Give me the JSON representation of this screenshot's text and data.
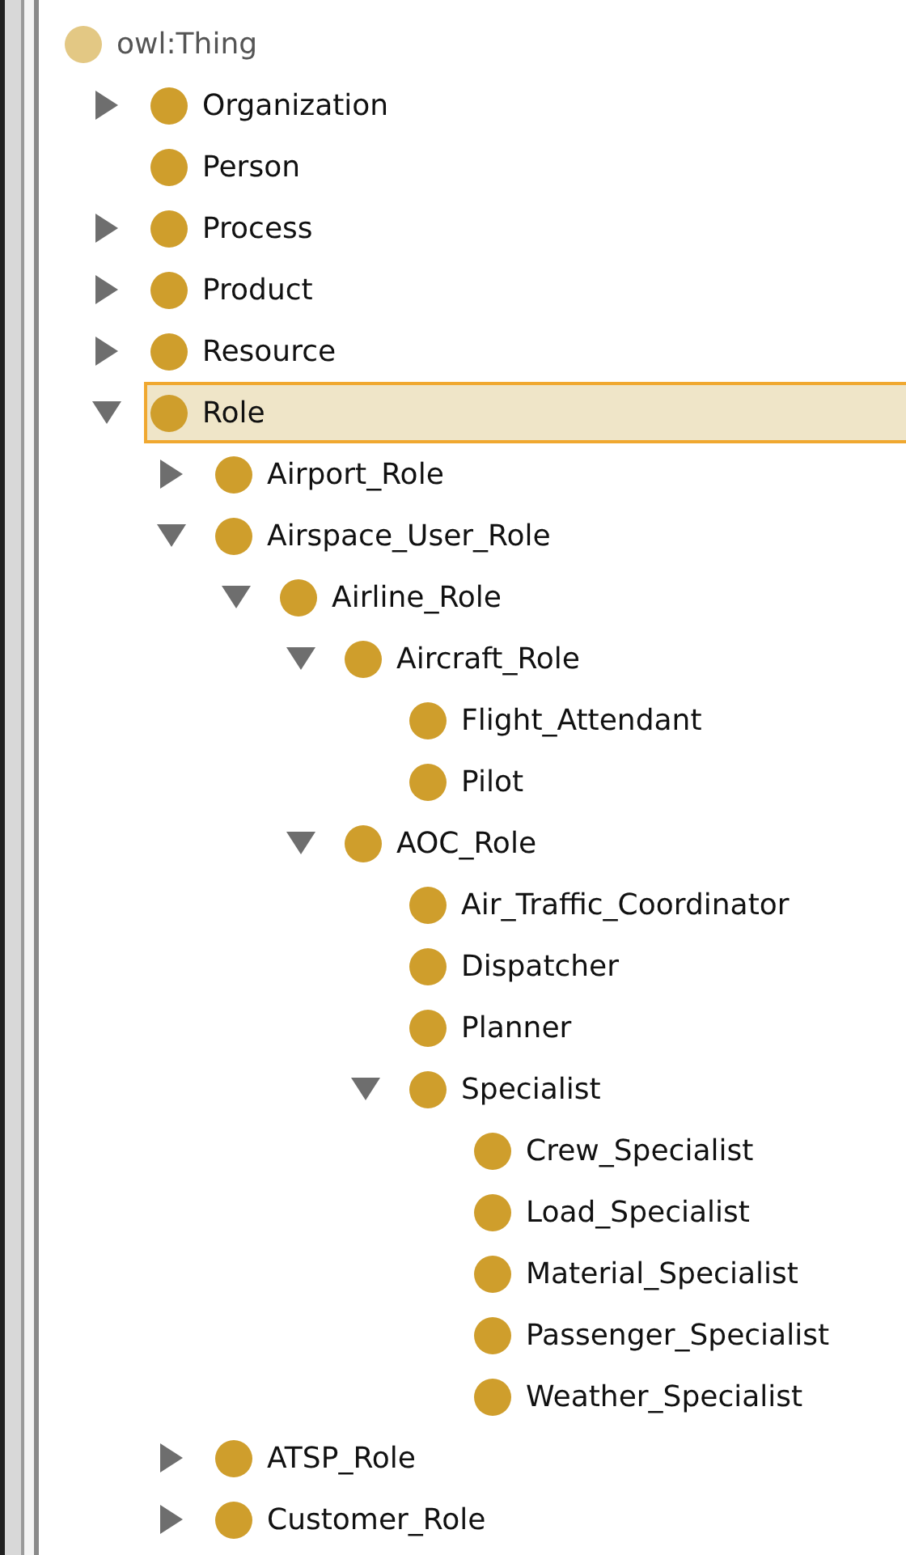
{
  "tree": {
    "label": "owl:Thing",
    "selected": false,
    "children": [
      {
        "label": "Organization",
        "expanded": false,
        "selected": false
      },
      {
        "label": "Person",
        "selected": false
      },
      {
        "label": "Process",
        "expanded": false,
        "selected": false
      },
      {
        "label": "Product",
        "expanded": false,
        "selected": false
      },
      {
        "label": "Resource",
        "expanded": false,
        "selected": false
      },
      {
        "label": "Role",
        "expanded": true,
        "selected": true,
        "children": [
          {
            "label": "Airport_Role",
            "expanded": false,
            "selected": false
          },
          {
            "label": "Airspace_User_Role",
            "expanded": true,
            "selected": false,
            "children": [
              {
                "label": "Airline_Role",
                "expanded": true,
                "selected": false,
                "children": [
                  {
                    "label": "Aircraft_Role",
                    "expanded": true,
                    "selected": false,
                    "children": [
                      {
                        "label": "Flight_Attendant",
                        "selected": false
                      },
                      {
                        "label": "Pilot",
                        "selected": false
                      }
                    ]
                  },
                  {
                    "label": "AOC_Role",
                    "expanded": true,
                    "selected": false,
                    "children": [
                      {
                        "label": "Air_Traffic_Coordinator",
                        "selected": false
                      },
                      {
                        "label": "Dispatcher",
                        "selected": false
                      },
                      {
                        "label": "Planner",
                        "selected": false
                      },
                      {
                        "label": "Specialist",
                        "expanded": true,
                        "selected": false,
                        "children": [
                          {
                            "label": "Crew_Specialist",
                            "selected": false
                          },
                          {
                            "label": "Load_Specialist",
                            "selected": false
                          },
                          {
                            "label": "Material_Specialist",
                            "selected": false
                          },
                          {
                            "label": "Passenger_Specialist",
                            "selected": false
                          },
                          {
                            "label": "Weather_Specialist",
                            "selected": false
                          }
                        ]
                      }
                    ]
                  }
                ]
              }
            ]
          },
          {
            "label": "ATSP_Role",
            "expanded": false,
            "selected": false
          },
          {
            "label": "Customer_Role",
            "expanded": false,
            "selected": false
          }
        ]
      }
    ]
  }
}
